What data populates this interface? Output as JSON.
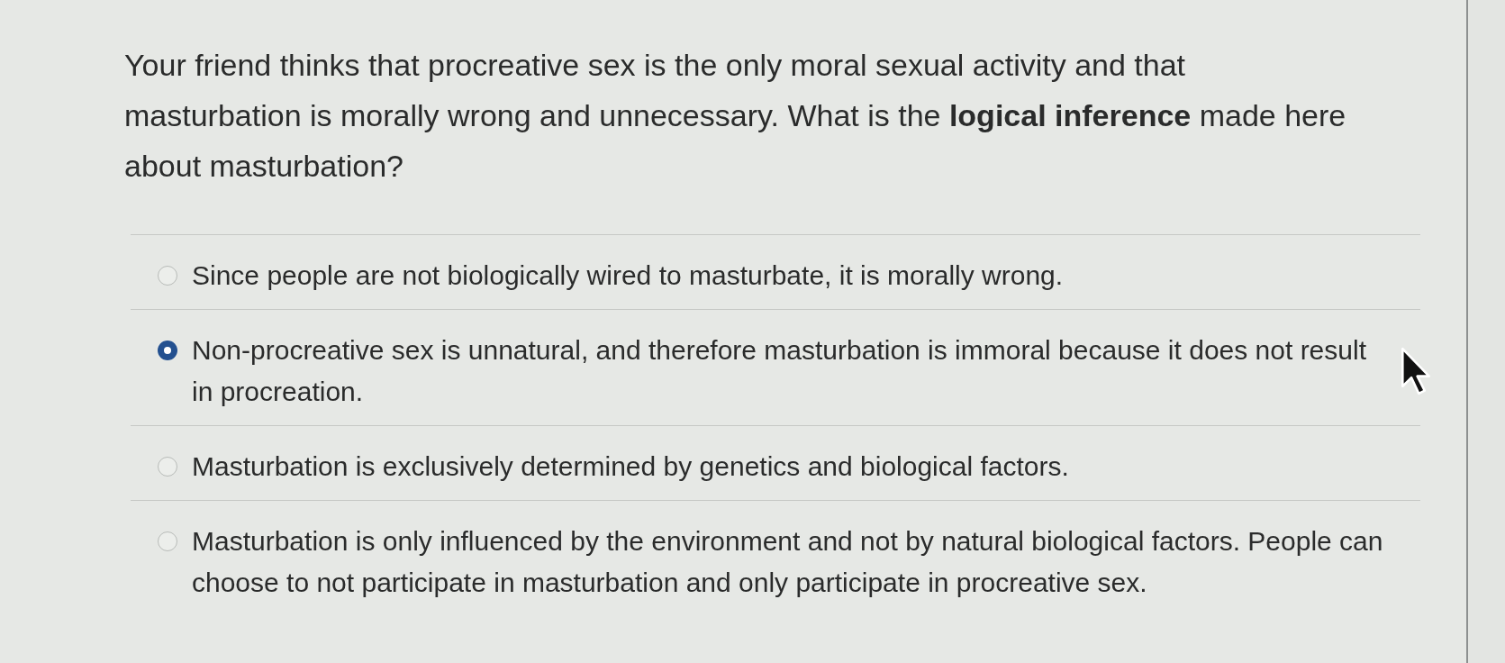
{
  "question": {
    "text": "Your friend thinks that procreative sex is the only moral sexual activity and that masturbation is morally wrong and unnecessary. What is the **logical inference** made here about masturbation?"
  },
  "options": [
    {
      "label": "Since people are not biologically wired to masturbate, it is morally wrong.",
      "selected": false
    },
    {
      "label": "Non-procreative sex is unnatural, and therefore masturbation is immoral because it does not result in procreation.",
      "selected": true
    },
    {
      "label": "Masturbation is exclusively determined by genetics and biological factors.",
      "selected": false
    },
    {
      "label": "Masturbation is only influenced by the environment and not by natural biological factors. People can choose to not participate in masturbation and only participate in procreative sex.",
      "selected": false
    }
  ]
}
